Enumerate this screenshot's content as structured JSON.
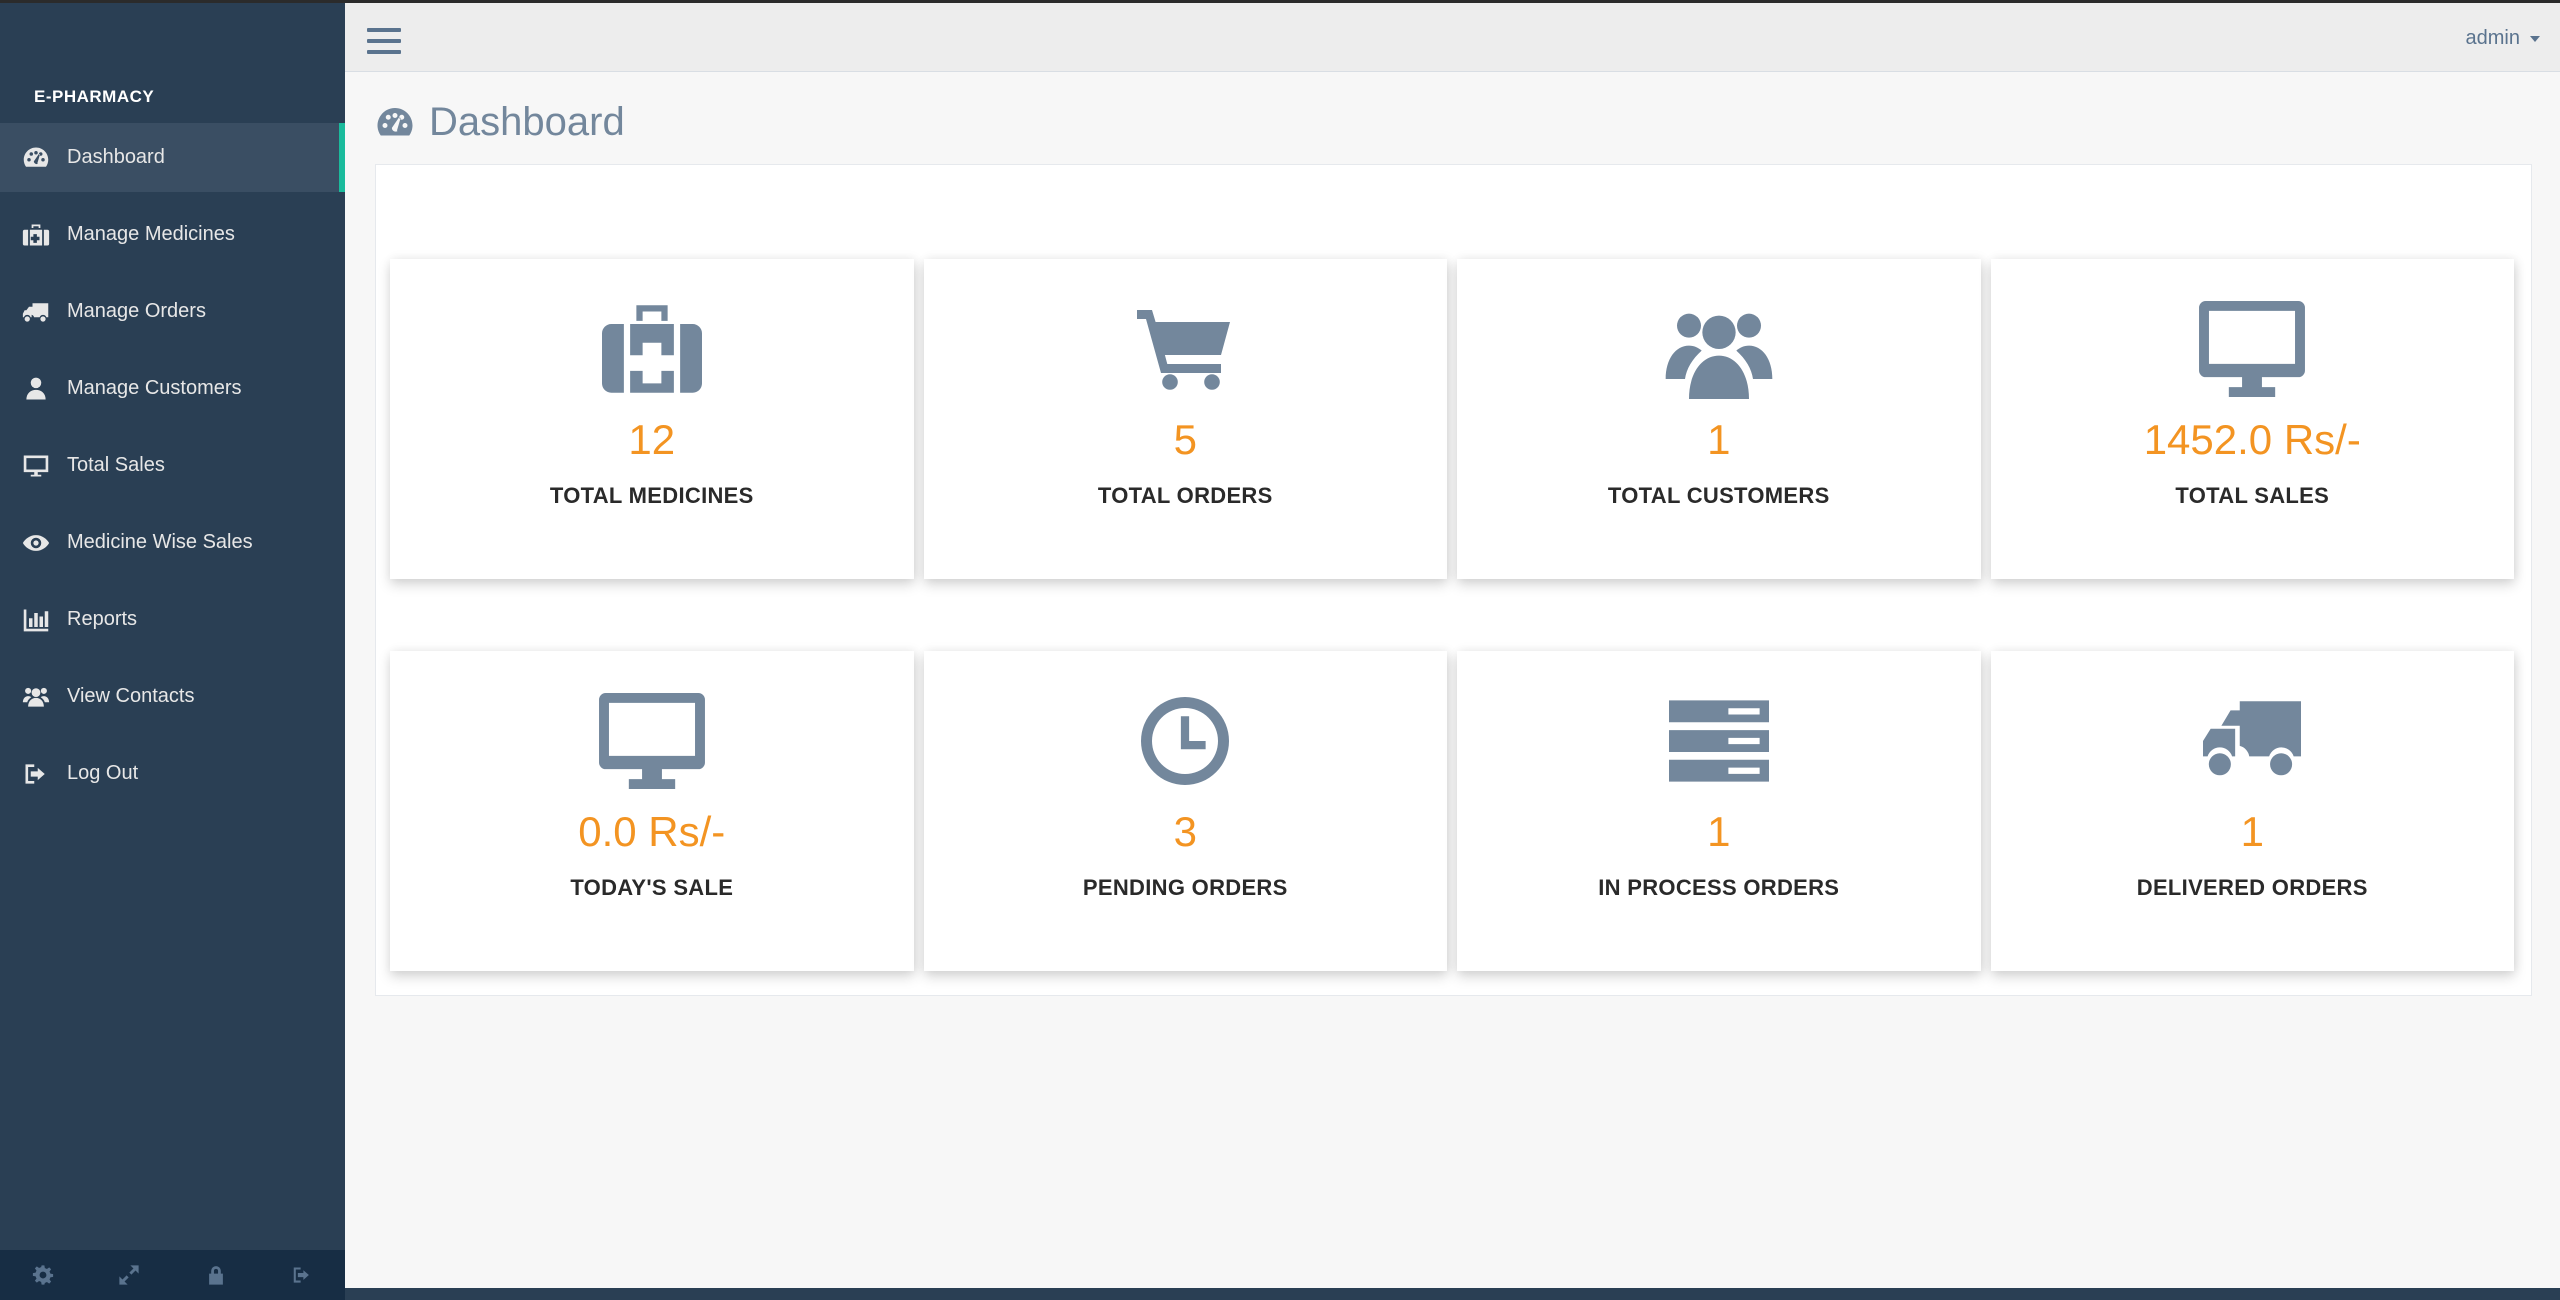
{
  "app": {
    "brand": "E-PHARMACY"
  },
  "topnav": {
    "user": "admin"
  },
  "page": {
    "title": "Dashboard"
  },
  "sidebar": {
    "items": [
      {
        "label": "Dashboard",
        "icon": "dashboard-icon",
        "active": true
      },
      {
        "label": "Manage Medicines",
        "icon": "medkit-icon"
      },
      {
        "label": "Manage Orders",
        "icon": "truck-icon"
      },
      {
        "label": "Manage Customers",
        "icon": "user-icon"
      },
      {
        "label": "Total Sales",
        "icon": "desktop-icon"
      },
      {
        "label": "Medicine Wise Sales",
        "icon": "eye-icon"
      },
      {
        "label": "Reports",
        "icon": "bar-chart-icon"
      },
      {
        "label": "View Contacts",
        "icon": "users-icon"
      },
      {
        "label": "Log Out",
        "icon": "sign-out-icon"
      }
    ],
    "footer_icons": [
      "settings-icon",
      "fullscreen-icon",
      "lock-icon",
      "logout-icon"
    ]
  },
  "stats": [
    {
      "value": "12",
      "label": "TOTAL MEDICINES",
      "icon": "medkit-icon"
    },
    {
      "value": "5",
      "label": "TOTAL ORDERS",
      "icon": "cart-icon"
    },
    {
      "value": "1",
      "label": "TOTAL CUSTOMERS",
      "icon": "users-icon"
    },
    {
      "value": "1452.0 Rs/-",
      "label": "TOTAL SALES",
      "icon": "desktop-icon"
    },
    {
      "value": "0.0 Rs/-",
      "label": "TODAY'S SALE",
      "icon": "desktop-icon"
    },
    {
      "value": "3",
      "label": "PENDING ORDERS",
      "icon": "clock-icon"
    },
    {
      "value": "1",
      "label": "IN PROCESS ORDERS",
      "icon": "server-icon"
    },
    {
      "value": "1",
      "label": "DELIVERED ORDERS",
      "icon": "truck-icon"
    }
  ],
  "colors": {
    "sidebar_bg": "#2a3f54",
    "active_indicator": "#1abb9c",
    "icon_gray": "#73879c",
    "value_orange": "#f39422"
  }
}
